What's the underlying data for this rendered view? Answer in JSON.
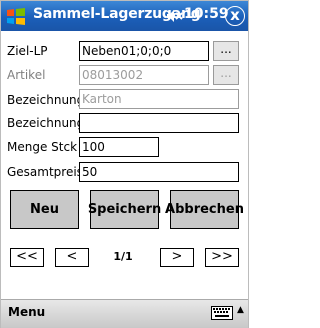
{
  "window": {
    "title": "Sammel-Lagerzugang",
    "time": "10:59",
    "close_label": "x"
  },
  "form": {
    "ziel_lp": {
      "label": "Ziel-LP",
      "value": "Neben01;0;0;0",
      "browse": "..."
    },
    "artikel": {
      "label": "Artikel",
      "value": "08013002",
      "browse": "..."
    },
    "bezeichnung1": {
      "label": "Bezeichnung",
      "value": "Karton"
    },
    "bezeichnung2": {
      "label": "Bezeichnung",
      "value": ""
    },
    "menge": {
      "label": "Menge  Stck",
      "value": "100"
    },
    "gesamtpreis": {
      "label": "Gesamtpreis",
      "value": "50"
    }
  },
  "actions": {
    "new": "Neu",
    "save": "Speichern",
    "cancel": "Abbrechen"
  },
  "pager": {
    "first": "<<",
    "prev": "<",
    "page": "1/1",
    "next": ">",
    "last": ">>"
  },
  "bottom": {
    "menu": "Menu"
  },
  "icons": {
    "start": "windows-flag-icon",
    "speaker": "speaker-muted-icon",
    "keyboard": "keyboard-icon",
    "accent": "#1b5fb9"
  }
}
